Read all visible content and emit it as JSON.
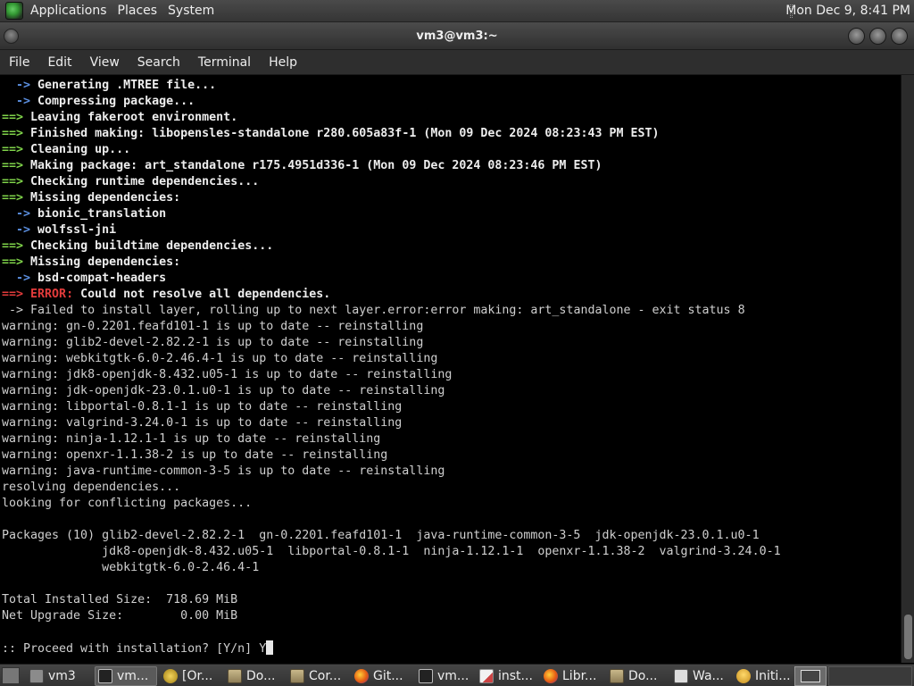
{
  "top_panel": {
    "menus": [
      "Applications",
      "Places",
      "System"
    ],
    "clock": "Mon Dec 9,  8:41 PM"
  },
  "window": {
    "title": "vm3@vm3:~",
    "menubar": [
      "File",
      "Edit",
      "View",
      "Search",
      "Terminal",
      "Help"
    ]
  },
  "terminal": {
    "lines": [
      {
        "arrow": "  ->",
        "arrow_class": "arrow-b",
        "text": " Generating .MTREE file...",
        "bold": true
      },
      {
        "arrow": "  ->",
        "arrow_class": "arrow-b",
        "text": " Compressing package...",
        "bold": true
      },
      {
        "arrow": "==>",
        "arrow_class": "arrow-g",
        "text": " Leaving fakeroot environment.",
        "bold": true
      },
      {
        "arrow": "==>",
        "arrow_class": "arrow-g",
        "text": " Finished making: libopensles-standalone r280.605a83f-1 (Mon 09 Dec 2024 08:23:43 PM EST)",
        "bold": true
      },
      {
        "arrow": "==>",
        "arrow_class": "arrow-g",
        "text": " Cleaning up...",
        "bold": true
      },
      {
        "arrow": "==>",
        "arrow_class": "arrow-g",
        "text": " Making package: art_standalone r175.4951d336-1 (Mon 09 Dec 2024 08:23:46 PM EST)",
        "bold": true
      },
      {
        "arrow": "==>",
        "arrow_class": "arrow-g",
        "text": " Checking runtime dependencies...",
        "bold": true
      },
      {
        "arrow": "==>",
        "arrow_class": "arrow-g",
        "text": " Missing dependencies:",
        "bold": true
      },
      {
        "arrow": "  ->",
        "arrow_class": "arrow-b",
        "text": " bionic_translation",
        "bold": true
      },
      {
        "arrow": "  ->",
        "arrow_class": "arrow-b",
        "text": " wolfssl-jni",
        "bold": true
      },
      {
        "arrow": "==>",
        "arrow_class": "arrow-g",
        "text": " Checking buildtime dependencies...",
        "bold": true
      },
      {
        "arrow": "==>",
        "arrow_class": "arrow-g",
        "text": " Missing dependencies:",
        "bold": true
      },
      {
        "arrow": "  ->",
        "arrow_class": "arrow-b",
        "text": " bsd-compat-headers",
        "bold": true
      },
      {
        "arrow": "==>",
        "arrow_class": "arrow-r",
        "err": " ERROR:",
        "text": " Could not resolve all dependencies.",
        "bold": true
      },
      {
        "arrow": " ->",
        "arrow_class": "",
        "text": " Failed to install layer, rolling up to next layer.error:error making: art_standalone - exit status 8",
        "bold": false
      },
      {
        "arrow": "",
        "text": "warning: gn-0.2201.feafd101-1 is up to date -- reinstalling",
        "bold": false
      },
      {
        "arrow": "",
        "text": "warning: glib2-devel-2.82.2-1 is up to date -- reinstalling",
        "bold": false
      },
      {
        "arrow": "",
        "text": "warning: webkitgtk-6.0-2.46.4-1 is up to date -- reinstalling",
        "bold": false
      },
      {
        "arrow": "",
        "text": "warning: jdk8-openjdk-8.432.u05-1 is up to date -- reinstalling",
        "bold": false
      },
      {
        "arrow": "",
        "text": "warning: jdk-openjdk-23.0.1.u0-1 is up to date -- reinstalling",
        "bold": false
      },
      {
        "arrow": "",
        "text": "warning: libportal-0.8.1-1 is up to date -- reinstalling",
        "bold": false
      },
      {
        "arrow": "",
        "text": "warning: valgrind-3.24.0-1 is up to date -- reinstalling",
        "bold": false
      },
      {
        "arrow": "",
        "text": "warning: ninja-1.12.1-1 is up to date -- reinstalling",
        "bold": false
      },
      {
        "arrow": "",
        "text": "warning: openxr-1.1.38-2 is up to date -- reinstalling",
        "bold": false
      },
      {
        "arrow": "",
        "text": "warning: java-runtime-common-3-5 is up to date -- reinstalling",
        "bold": false
      },
      {
        "arrow": "",
        "text": "resolving dependencies...",
        "bold": false
      },
      {
        "arrow": "",
        "text": "looking for conflicting packages...",
        "bold": false
      },
      {
        "arrow": "",
        "text": "",
        "bold": false
      },
      {
        "arrow": "",
        "text": "Packages (10) glib2-devel-2.82.2-1  gn-0.2201.feafd101-1  java-runtime-common-3-5  jdk-openjdk-23.0.1.u0-1",
        "bold": false
      },
      {
        "arrow": "",
        "text": "              jdk8-openjdk-8.432.u05-1  libportal-0.8.1-1  ninja-1.12.1-1  openxr-1.1.38-2  valgrind-3.24.0-1",
        "bold": false
      },
      {
        "arrow": "",
        "text": "              webkitgtk-6.0-2.46.4-1",
        "bold": false
      },
      {
        "arrow": "",
        "text": "",
        "bold": false
      },
      {
        "arrow": "",
        "text": "Total Installed Size:  718.69 MiB",
        "bold": false
      },
      {
        "arrow": "",
        "text": "Net Upgrade Size:        0.00 MiB",
        "bold": false
      },
      {
        "arrow": "",
        "text": "",
        "bold": false
      },
      {
        "arrow": "",
        "text": ":: Proceed with installation? [Y/n] Y",
        "bold": false,
        "cursor": true
      }
    ]
  },
  "taskbar": {
    "tasks": [
      {
        "label": "vm3",
        "icon": "home-icon",
        "active": false
      },
      {
        "label": "vm...",
        "icon": "terminal-icon",
        "active": true
      },
      {
        "label": "[Or...",
        "icon": "help-icon",
        "active": false
      },
      {
        "label": "Do...",
        "icon": "folder-icon",
        "active": false
      },
      {
        "label": "Cor...",
        "icon": "folder-icon",
        "active": false
      },
      {
        "label": "Git...",
        "icon": "firefox-icon",
        "active": false
      },
      {
        "label": "vm...",
        "icon": "terminal-icon",
        "active": false
      },
      {
        "label": "inst...",
        "icon": "text-editor-icon",
        "active": false
      },
      {
        "label": "Libr...",
        "icon": "firefox-icon",
        "active": false
      },
      {
        "label": "Do...",
        "icon": "folder-icon",
        "active": false
      },
      {
        "label": "Wa...",
        "icon": "window-icon",
        "active": false
      },
      {
        "label": "Initi...",
        "icon": "wine-icon",
        "active": false
      }
    ]
  }
}
